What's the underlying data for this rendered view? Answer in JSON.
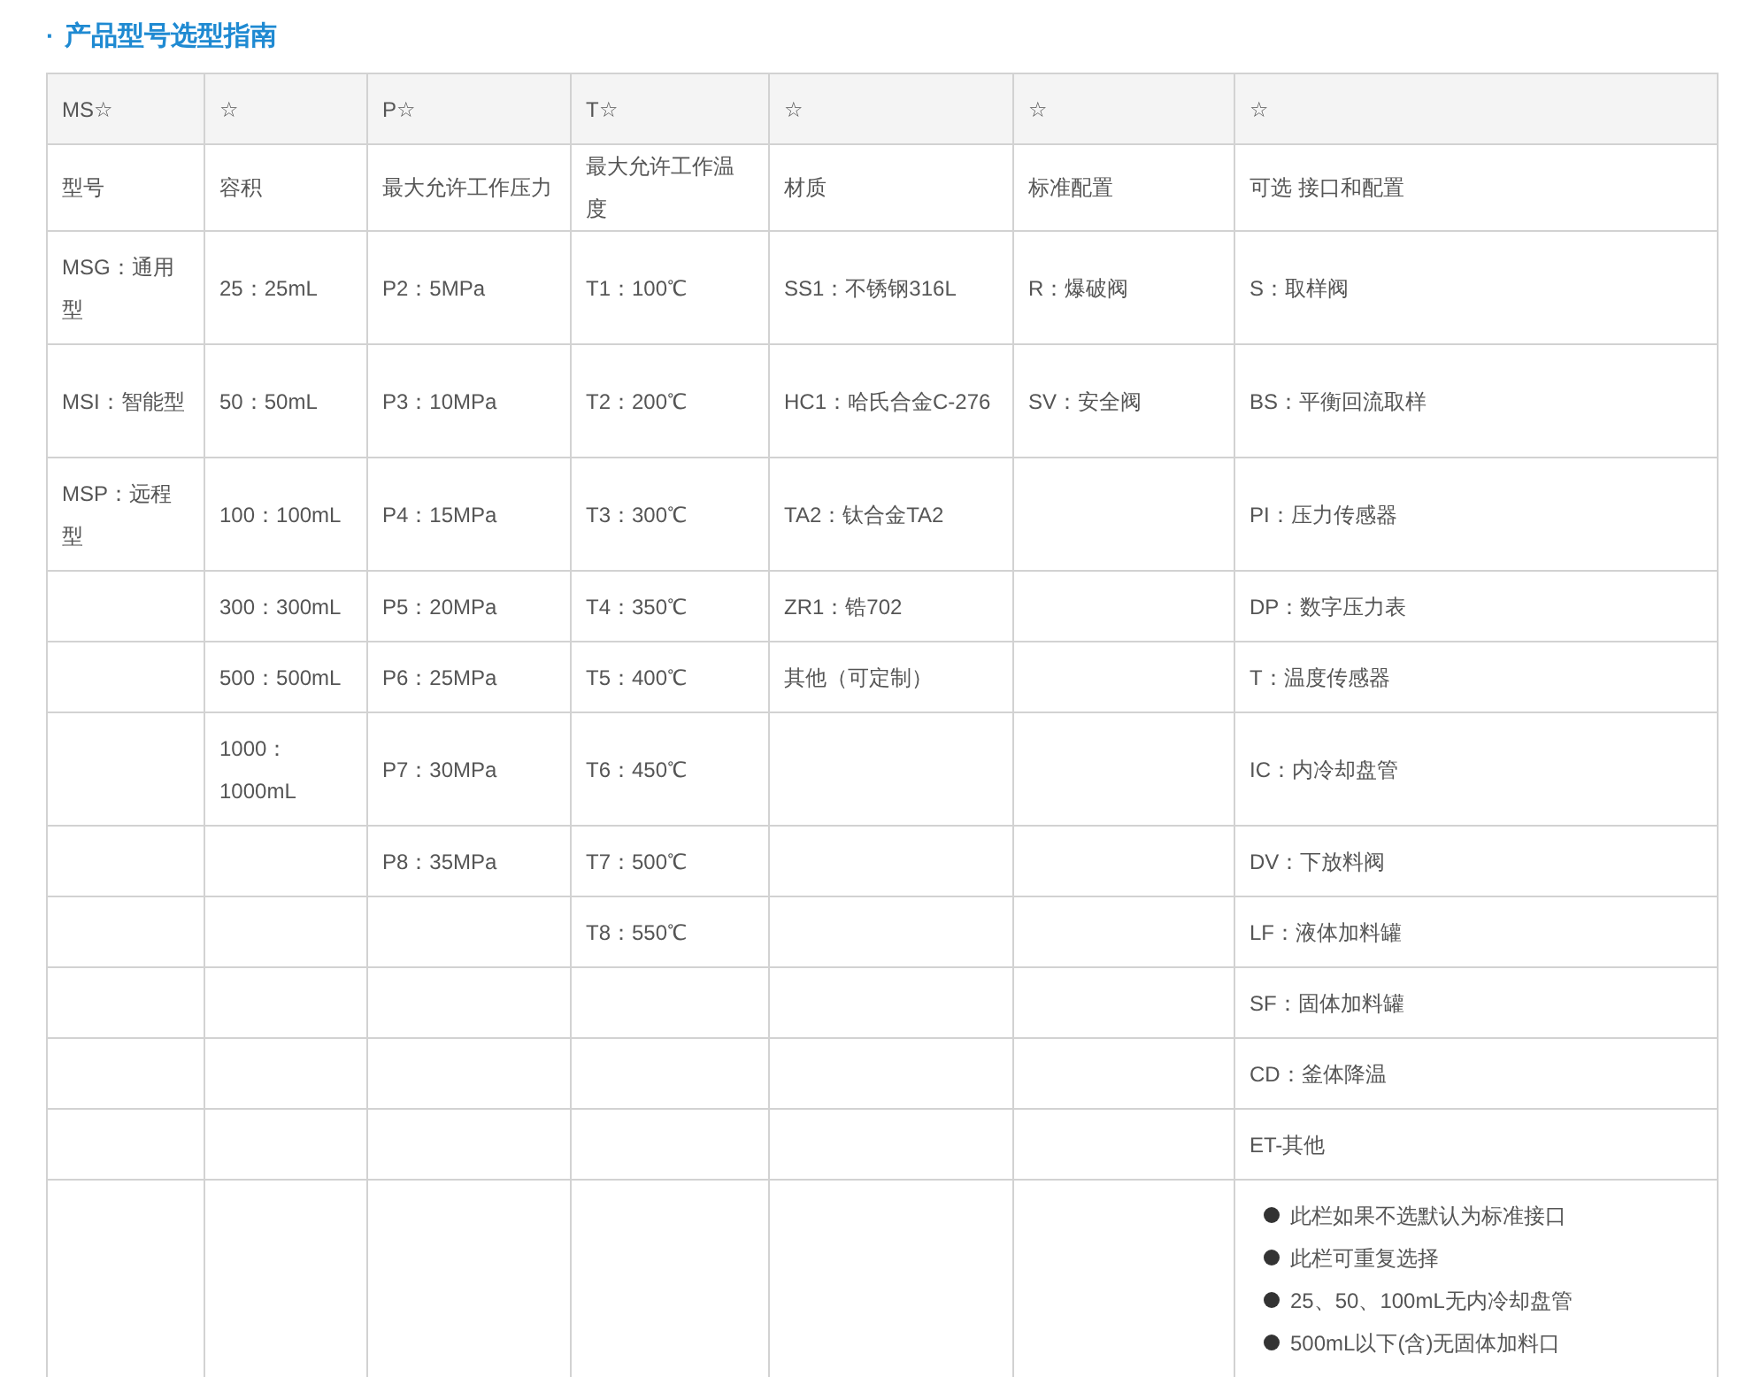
{
  "title": {
    "marker": "·",
    "text": "产品型号选型指南"
  },
  "table": {
    "header": [
      "MS☆",
      "☆",
      "P☆",
      "T☆",
      "☆",
      "☆",
      "☆"
    ],
    "rows": [
      {
        "cells": [
          "型号",
          "容积",
          "最大允许工作压力",
          "最大允许工作温度",
          "材质",
          "标准配置",
          "可选 接口和配置"
        ]
      },
      {
        "cells": [
          "MSG：通用型",
          "25：25mL",
          "P2：5MPa",
          "T1：100℃",
          "SS1：不锈钢316L",
          "R：爆破阀",
          "S：取样阀"
        ]
      },
      {
        "cells": [
          "MSI：智能型",
          "50：50mL",
          "P3：10MPa",
          "T2：200℃",
          "HC1：哈氏合金C-276",
          "SV：安全阀",
          "BS：平衡回流取样"
        ]
      },
      {
        "cells": [
          "MSP：远程型",
          "100：100mL",
          "P4：15MPa",
          "T3：300℃",
          "TA2：钛合金TA2",
          null,
          "PI：压力传感器"
        ]
      },
      {
        "cells": [
          null,
          "300：300mL",
          "P5：20MPa",
          "T4：350℃",
          "ZR1：锆702",
          null,
          "DP：数字压力表"
        ]
      },
      {
        "cells": [
          null,
          "500：500mL",
          "P6：25MPa",
          "T5：400℃",
          "其他（可定制）",
          null,
          "T：温度传感器"
        ]
      },
      {
        "cells": [
          null,
          "1000：1000mL",
          "P7：30MPa",
          "T6：450℃",
          null,
          null,
          "IC：内冷却盘管"
        ]
      },
      {
        "cells": [
          null,
          null,
          "P8：35MPa",
          "T7：500℃",
          null,
          null,
          "DV：下放料阀"
        ]
      },
      {
        "cells": [
          null,
          null,
          null,
          "T8：550℃",
          null,
          null,
          "LF：液体加料罐"
        ]
      },
      {
        "cells": [
          null,
          null,
          null,
          null,
          null,
          null,
          "SF：固体加料罐"
        ]
      },
      {
        "cells": [
          null,
          null,
          null,
          null,
          null,
          null,
          "CD：釜体降温"
        ]
      },
      {
        "cells": [
          null,
          null,
          null,
          null,
          null,
          null,
          "ET-其他"
        ]
      },
      {
        "cells": [
          null,
          null,
          null,
          null,
          null,
          null,
          null
        ],
        "notes": [
          "此栏如果不选默认为标准接口",
          "此栏可重复选择",
          "25、50、100mL无内冷却盘管",
          "500mL以下(含)无固体加料口"
        ]
      }
    ]
  }
}
